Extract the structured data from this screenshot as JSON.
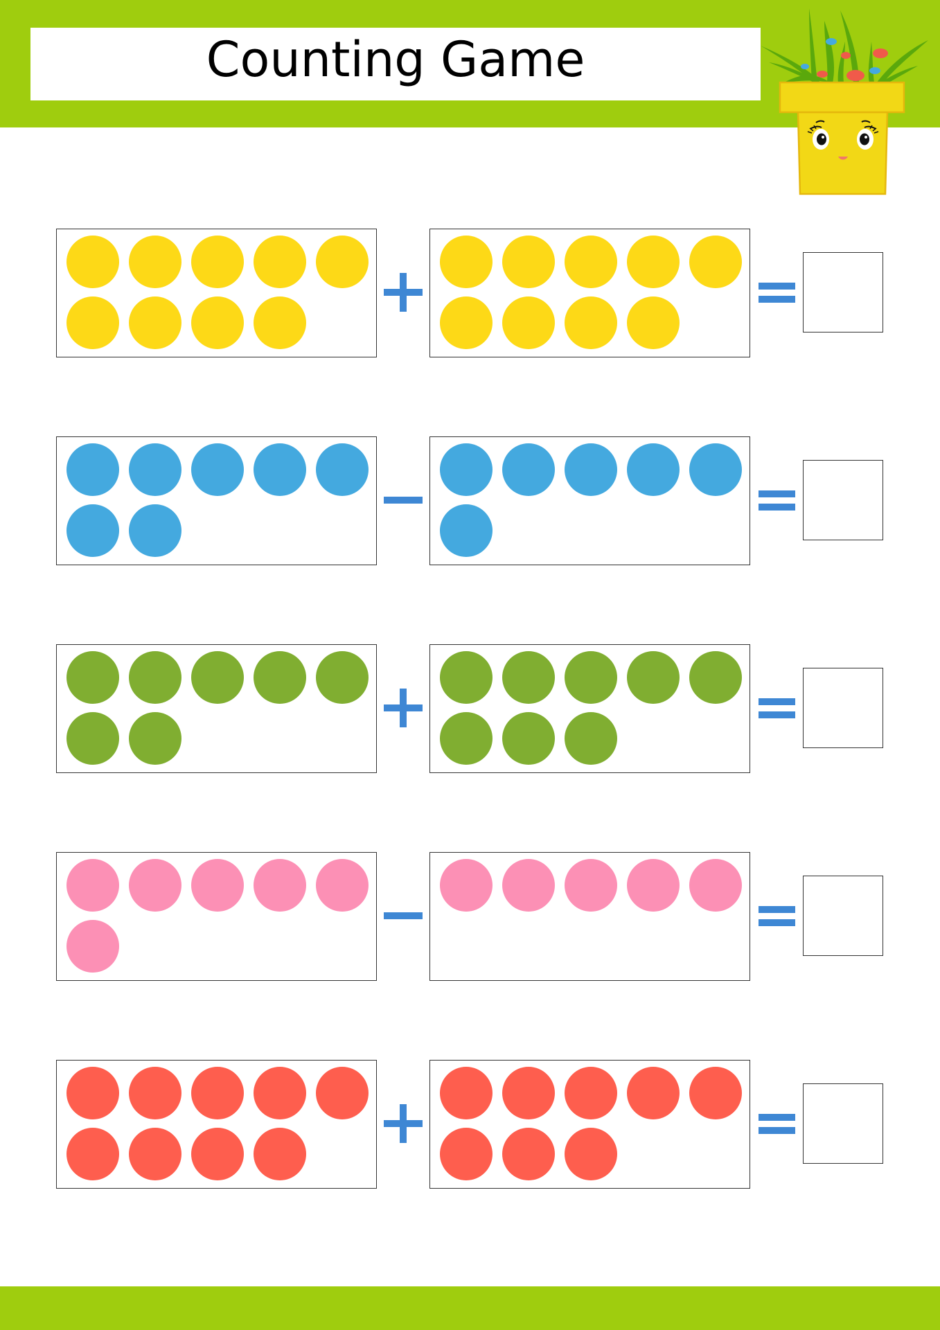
{
  "title": "Counting Game",
  "colors": {
    "band": "#9fcd0e",
    "operator": "#3e87d4"
  },
  "mascot": {
    "name": "flower-pot-mascot",
    "pot_color": "#f2d816",
    "leaf_color": "#5aa80c",
    "flower_colors": [
      "#f05a4a",
      "#45a9e0"
    ]
  },
  "problems": [
    {
      "color": "#fdd917",
      "left_count": 9,
      "operator": "+",
      "right_count": 9,
      "answer": ""
    },
    {
      "color": "#44a9df",
      "left_count": 7,
      "operator": "-",
      "right_count": 6,
      "answer": ""
    },
    {
      "color": "#80ae31",
      "left_count": 7,
      "operator": "+",
      "right_count": 8,
      "answer": ""
    },
    {
      "color": "#fc90b5",
      "left_count": 6,
      "operator": "-",
      "right_count": 5,
      "answer": ""
    },
    {
      "color": "#fe5e4e",
      "left_count": 9,
      "operator": "+",
      "right_count": 8,
      "answer": ""
    }
  ]
}
